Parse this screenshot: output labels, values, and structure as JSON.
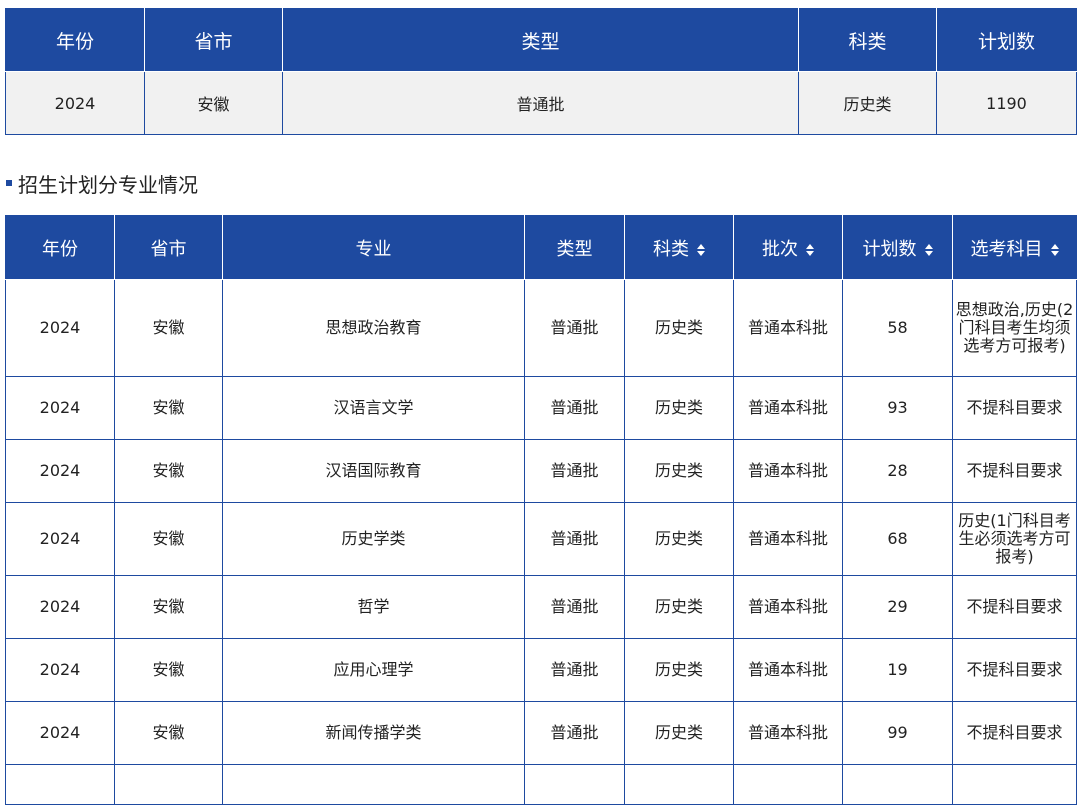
{
  "summary": {
    "headers": [
      "年份",
      "省市",
      "类型",
      "科类",
      "计划数"
    ],
    "row": [
      "2024",
      "安徽",
      "普通批",
      "历史类",
      "1190"
    ]
  },
  "section_title": "招生计划分专业情况",
  "majors": {
    "headers": [
      "年份",
      "省市",
      "专业",
      "类型",
      "科类",
      "批次",
      "计划数",
      "选考科目"
    ],
    "sortable": [
      false,
      false,
      false,
      false,
      true,
      true,
      true,
      true
    ],
    "rows": [
      [
        "2024",
        "安徽",
        "思想政治教育",
        "普通批",
        "历史类",
        "普通本科批",
        "58",
        "思想政治,历史(2门科目考生均须选考方可报考)"
      ],
      [
        "2024",
        "安徽",
        "汉语言文学",
        "普通批",
        "历史类",
        "普通本科批",
        "93",
        "不提科目要求"
      ],
      [
        "2024",
        "安徽",
        "汉语国际教育",
        "普通批",
        "历史类",
        "普通本科批",
        "28",
        "不提科目要求"
      ],
      [
        "2024",
        "安徽",
        "历史学类",
        "普通批",
        "历史类",
        "普通本科批",
        "68",
        "历史(1门科目考生必须选考方可报考)"
      ],
      [
        "2024",
        "安徽",
        "哲学",
        "普通批",
        "历史类",
        "普通本科批",
        "29",
        "不提科目要求"
      ],
      [
        "2024",
        "安徽",
        "应用心理学",
        "普通批",
        "历史类",
        "普通本科批",
        "19",
        "不提科目要求"
      ],
      [
        "2024",
        "安徽",
        "新闻传播学类",
        "普通批",
        "历史类",
        "普通本科批",
        "99",
        "不提科目要求"
      ]
    ]
  },
  "colors": {
    "header_bg": "#1e4aa0",
    "border": "#1e4aa0",
    "summary_row_bg": "#f1f1f1"
  },
  "icons": {
    "sort": "sort-icon",
    "section_marker": "square-bullet-icon"
  }
}
